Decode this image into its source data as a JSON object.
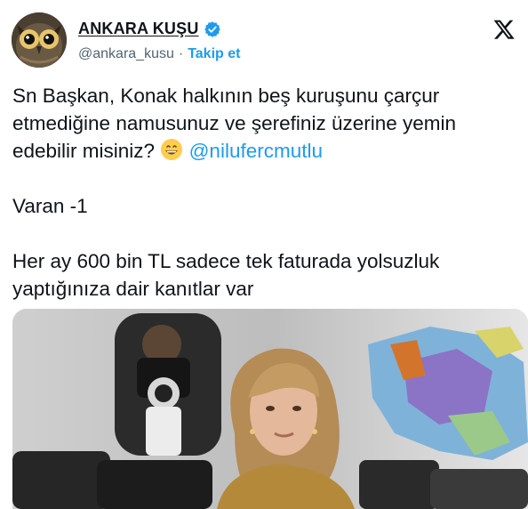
{
  "author": {
    "display_name": "ANKARA KUŞU",
    "handle": "@ankara_kusu",
    "separator": "·",
    "follow_label": "Takip et",
    "verified": true
  },
  "platform_icon": "x-logo-icon",
  "tweet": {
    "line1_text": "Sn Başkan, Konak halkının beş kuruşunu çarçur etmediğine namusunuz ve şerefiniz üzerine yemin edebilir misiniz?",
    "emoji_icon": "grinning-face-emoji-icon",
    "mention": "@nilufercmutlu",
    "line2": "Varan -1",
    "line3": "Her ay 600 bin TL sadece tek faturada yolsuzluk yaptığınıza dair kanıtlar var"
  },
  "colors": {
    "accent": "#1d9bf0",
    "text": "#0f1419",
    "secondary_text": "#536471"
  }
}
